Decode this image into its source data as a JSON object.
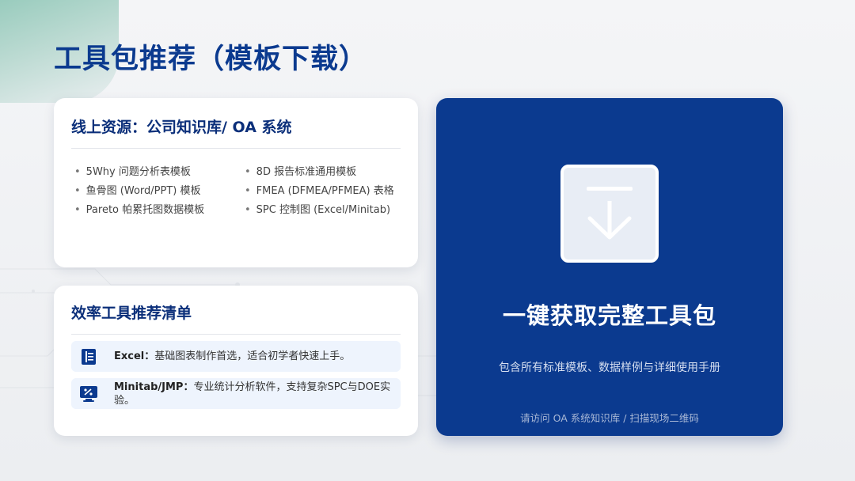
{
  "page": {
    "title": "工具包推荐（模板下载）"
  },
  "online_resources": {
    "title": "线上资源：公司知识库/ OA 系统",
    "items": [
      "5Why 问题分析表模板",
      "8D 报告标准通用模板",
      "鱼骨图 (Word/PPT) 模板",
      "FMEA (DFMEA/PFMEA) 表格",
      "Pareto 帕累托图数据模板",
      "SPC 控制图 (Excel/Minitab)"
    ]
  },
  "tools": {
    "title": "效率工具推荐清单",
    "items": [
      {
        "name": "Excel：",
        "desc": "基础图表制作首选，适合初学者快速上手。",
        "icon": "spreadsheet-icon"
      },
      {
        "name": "Minitab/JMP：",
        "desc": "专业统计分析软件，支持复杂SPC与DOE实验。",
        "icon": "stats-monitor-icon"
      }
    ]
  },
  "cta": {
    "icon": "download-icon",
    "title": "一键获取完整工具包",
    "subtitle": "包含所有标准模板、数据样例与详细使用手册",
    "note": "请访问 OA 系统知识库 / 扫描现场二维码"
  },
  "colors": {
    "brand_blue": "#0b3a8f",
    "title_blue": "#0b2f7a",
    "tool_row_bg": "#eef4fd"
  }
}
